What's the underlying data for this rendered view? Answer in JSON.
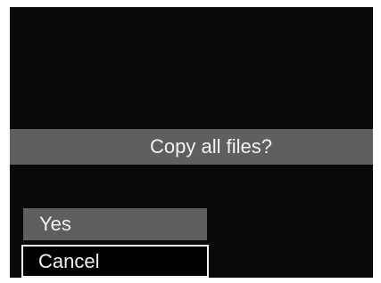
{
  "dialog": {
    "prompt": "Copy all files?",
    "options": [
      {
        "label": "Yes",
        "selected": false
      },
      {
        "label": "Cancel",
        "selected": true
      }
    ]
  },
  "colors": {
    "screen_background": "#0a0a0a",
    "bar_background": "#5f5f5f",
    "text": "#f2f2f2",
    "selection_border": "#f5f5f5"
  }
}
